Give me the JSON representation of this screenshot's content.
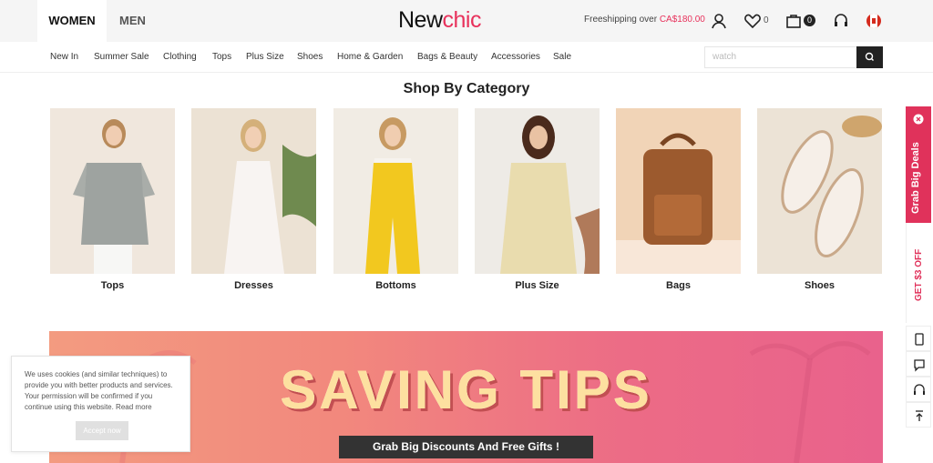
{
  "header": {
    "tabs": [
      {
        "label": "WOMEN"
      },
      {
        "label": "MEN"
      }
    ],
    "logo": {
      "prefix": "New",
      "accent": "chic"
    },
    "shipping": {
      "text": "Freeshipping over ",
      "amount": "CA$180.00"
    },
    "wishlist_count": "0",
    "cart_count": "0"
  },
  "nav": {
    "items": [
      "New In",
      "Summer Sale",
      "Clothing",
      "Tops",
      "Plus Size",
      "Shoes",
      "Home & Garden",
      "Bags & Beauty",
      "Accessories",
      "Sale"
    ]
  },
  "search": {
    "placeholder": "watch"
  },
  "section": {
    "title": "Shop By Category"
  },
  "categories": [
    {
      "label": "Tops"
    },
    {
      "label": "Dresses"
    },
    {
      "label": "Bottoms"
    },
    {
      "label": "Plus Size"
    },
    {
      "label": "Bags"
    },
    {
      "label": "Shoes"
    }
  ],
  "banner": {
    "title": "SAVING TIPS",
    "subtitle": "Grab Big Discounts And Free Gifts !"
  },
  "cookie": {
    "text": "We uses cookies (and similar techniques) to provide you with better products and services. Your permission will be confirmed if you continue using this website. Read more",
    "button": "Accept now"
  },
  "side_rail": {
    "grab": "Grab Big Deals",
    "get_off": "GET $3 OFF"
  },
  "colors": {
    "accent": "#e8325c",
    "dark": "#222222"
  }
}
